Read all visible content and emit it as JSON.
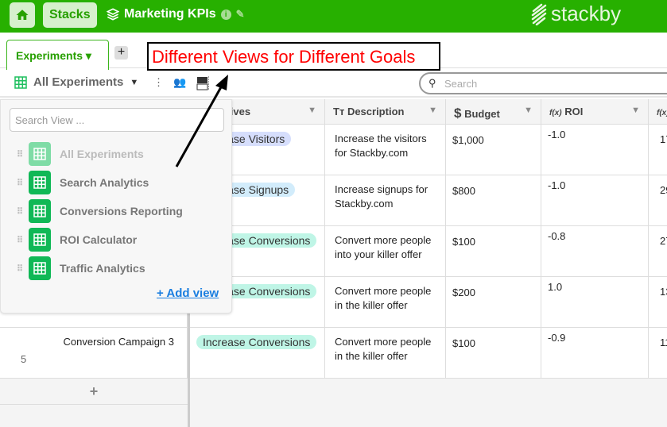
{
  "topbar": {
    "stacks_label": "Stacks",
    "stack_name": "Marketing KPIs",
    "logo": "stackby",
    "brand_color": "#27b000"
  },
  "tabs": [
    {
      "label": "Experiments ▾",
      "active": true
    }
  ],
  "add_tab": "+",
  "annotation": "Different Views for Different Goals",
  "toolbar": {
    "current_view": "All Experiments",
    "search_placeholder": "Search"
  },
  "columns": [
    {
      "icon": "",
      "label": "ectives"
    },
    {
      "icon": "Tт",
      "label": "Description"
    },
    {
      "icon": "$",
      "label": "Budget"
    },
    {
      "icon": "f(x)",
      "label": "ROI"
    },
    {
      "icon": "f(x)",
      "label": ""
    }
  ],
  "rows": [
    {
      "objective": "Increase Visitors",
      "obj_color": "#d6defc",
      "desc1": "Increase the visitors",
      "desc2": "for Stackby.com",
      "budget": "$1,000",
      "roi": "-1.0",
      "extra": "17"
    },
    {
      "objective": "Increase Signups",
      "obj_color": "#d2ecfb",
      "desc1": "Increase signups for",
      "desc2": "Stackby.com",
      "budget": "$800",
      "roi": "-1.0",
      "extra": "29"
    },
    {
      "objective": "Increase Conversions",
      "obj_color": "#bff5e6",
      "desc1": "Convert more people",
      "desc2": "into your killer offer",
      "budget": "$100",
      "roi": "-0.8",
      "extra": "27"
    },
    {
      "objective": "Increase Conversions",
      "obj_color": "#bff5e6",
      "desc1": "Convert more people",
      "desc2": "in the killer offer",
      "budget": "$200",
      "roi": "1.0",
      "extra": "13"
    },
    {
      "objective": "Increase Conversions",
      "obj_color": "#bff5e6",
      "desc1": "Convert more people",
      "desc2": "in the killer offer",
      "budget": "$100",
      "roi": "-0.9",
      "extra": "11",
      "name": "Conversion Campaign 3",
      "number": "5"
    }
  ],
  "add_row": "+",
  "view_menu": {
    "search_placeholder": "Search View ...",
    "views": [
      "All Experiments",
      "Search Analytics",
      "Conversions Reporting",
      "ROI Calculator",
      "Traffic Analytics"
    ],
    "add_view": "+ Add view"
  }
}
